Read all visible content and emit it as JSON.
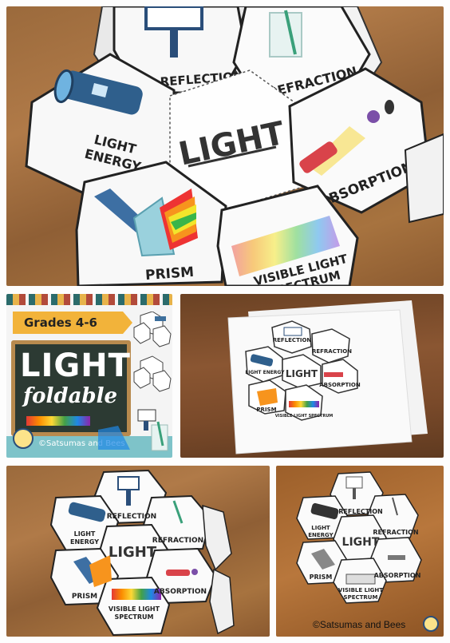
{
  "top": {
    "reflection": "REFLECTION",
    "refraction": "REFRACTION",
    "light_energy_1": "LIGHT",
    "light_energy_2": "ENERGY",
    "center": "LIGHT",
    "absorption": "ABSORPTION",
    "prism": "PRISM",
    "visible_1": "VISIBLE LIGHT",
    "visible_2": "SPECTRUM"
  },
  "cover": {
    "grades": "Grades 4-6",
    "title": "LIGHT",
    "subtitle": "foldable",
    "brand": "©Satsumas and Bees"
  },
  "sheet": {
    "reflection": "REFLECTION",
    "refraction": "REFRACTION",
    "light_energy": "LIGHT ENERGY",
    "center": "LIGHT",
    "absorption": "ABSORPTION",
    "prism": "PRISM",
    "visible": "VISIBLE LIGHT SPECTRUM"
  },
  "bl": {
    "reflection": "REFLECTION",
    "refraction": "REFRACTION",
    "light_energy_1": "LIGHT",
    "light_energy_2": "ENERGY",
    "center": "LIGHT",
    "absorption": "ABSORPTION",
    "prism": "PRISM",
    "visible_1": "VISIBLE LIGHT",
    "visible_2": "SPECTRUM"
  },
  "br": {
    "reflection": "REFLECTION",
    "refraction": "REFRACTION",
    "light_energy_1": "LIGHT",
    "light_energy_2": "ENERGY",
    "center": "LIGHT",
    "absorption": "ABSORPTION",
    "prism": "PRISM",
    "visible_1": "VISIBLE LIGHT",
    "visible_2": "SPECTRUM",
    "brand": "©Satsumas and Bees"
  },
  "colors": {
    "wood": "#a0703f",
    "chalk_green": "#2c3a33",
    "banner_yellow": "#f2b33a",
    "flashlight_blue": "#3d6f9c"
  }
}
